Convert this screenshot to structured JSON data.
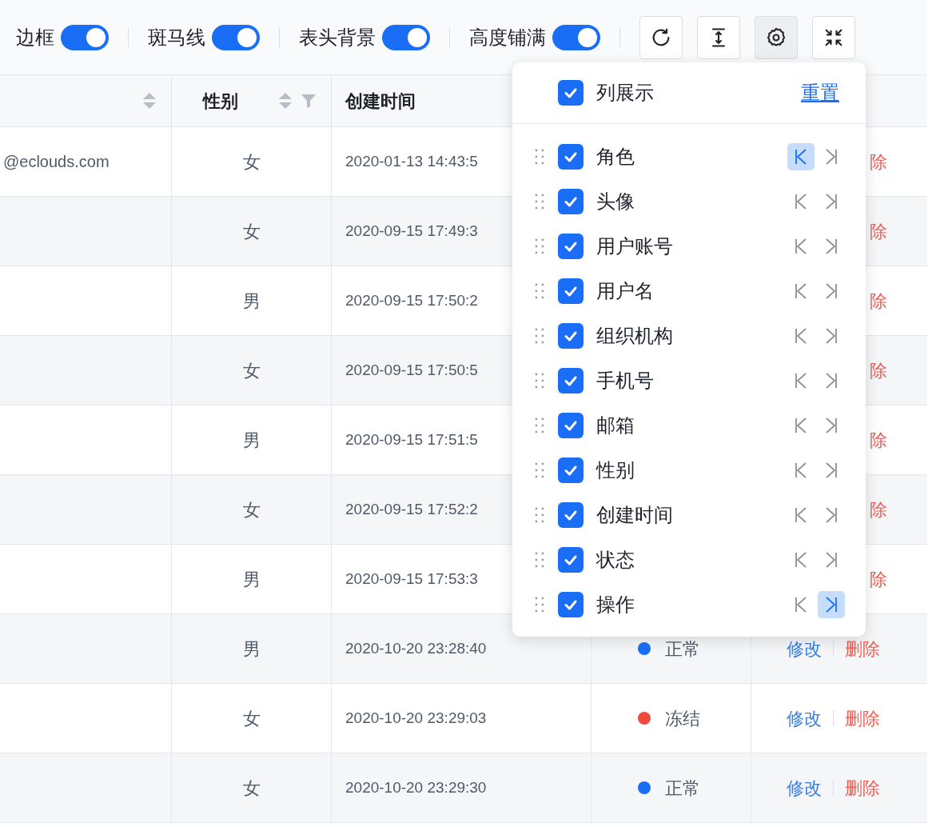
{
  "toolbar": {
    "toggles": [
      {
        "label": "边框",
        "on": true
      },
      {
        "label": "斑马线",
        "on": true
      },
      {
        "label": "表头背景",
        "on": true
      },
      {
        "label": "高度铺满",
        "on": true
      }
    ],
    "buttons": [
      {
        "kind": "refresh",
        "active": false
      },
      {
        "kind": "height",
        "active": false
      },
      {
        "kind": "settings",
        "active": true
      },
      {
        "kind": "fullscreen",
        "active": false
      }
    ]
  },
  "table": {
    "columns": [
      {
        "sortable": true
      },
      {
        "label": "性别",
        "sortable": true,
        "filterable": true
      },
      {
        "label": "创建时间"
      }
    ],
    "rows": [
      {
        "column_1": "@eclouds.com",
        "gender": "女",
        "created": "2020-01-13 14:43:5",
        "actions": [
          {
            "label": "除",
            "kind": "delete"
          }
        ]
      },
      {
        "gender": "女",
        "created": "2020-09-15 17:49:3",
        "actions": [
          {
            "label": "除",
            "kind": "delete"
          }
        ]
      },
      {
        "gender": "男",
        "created": "2020-09-15 17:50:2",
        "actions": [
          {
            "label": "除",
            "kind": "delete"
          }
        ]
      },
      {
        "gender": "女",
        "created": "2020-09-15 17:50:5",
        "actions": [
          {
            "label": "除",
            "kind": "delete"
          }
        ]
      },
      {
        "gender": "男",
        "created": "2020-09-15 17:51:5",
        "actions": [
          {
            "label": "除",
            "kind": "delete"
          }
        ]
      },
      {
        "gender": "女",
        "created": "2020-09-15 17:52:2",
        "actions": [
          {
            "label": "除",
            "kind": "delete"
          }
        ]
      },
      {
        "gender": "男",
        "created": "2020-09-15 17:53:3",
        "actions": [
          {
            "label": "除",
            "kind": "delete"
          }
        ]
      },
      {
        "gender": "男",
        "created": "2020-10-20 23:28:40",
        "status": {
          "label": "正常",
          "color": "#1a6ef5"
        },
        "actions": [
          {
            "label": "修改",
            "kind": "edit"
          },
          {
            "label": "删除",
            "kind": "delete"
          }
        ]
      },
      {
        "gender": "女",
        "created": "2020-10-20 23:29:03",
        "status": {
          "label": "冻结",
          "color": "#f04a3e"
        },
        "actions": [
          {
            "label": "修改",
            "kind": "edit"
          },
          {
            "label": "删除",
            "kind": "delete"
          }
        ]
      },
      {
        "gender": "女",
        "created": "2020-10-20 23:29:30",
        "status": {
          "label": "正常",
          "color": "#1a6ef5"
        },
        "actions": [
          {
            "label": "修改",
            "kind": "edit"
          },
          {
            "label": "删除",
            "kind": "delete"
          }
        ]
      }
    ]
  },
  "column_settings": {
    "title": "列展示",
    "all_checked": true,
    "reset": "重置",
    "columns": [
      {
        "label": "角色",
        "checked": true,
        "pinned_left": true,
        "pinned_right": false
      },
      {
        "label": "头像",
        "checked": true,
        "pinned_left": false,
        "pinned_right": false
      },
      {
        "label": "用户账号",
        "checked": true,
        "pinned_left": false,
        "pinned_right": false
      },
      {
        "label": "用户名",
        "checked": true,
        "pinned_left": false,
        "pinned_right": false
      },
      {
        "label": "组织机构",
        "checked": true,
        "pinned_left": false,
        "pinned_right": false
      },
      {
        "label": "手机号",
        "checked": true,
        "pinned_left": false,
        "pinned_right": false
      },
      {
        "label": "邮箱",
        "checked": true,
        "pinned_left": false,
        "pinned_right": false
      },
      {
        "label": "性别",
        "checked": true,
        "pinned_left": false,
        "pinned_right": false
      },
      {
        "label": "创建时间",
        "checked": true,
        "pinned_left": false,
        "pinned_right": false
      },
      {
        "label": "状态",
        "checked": true,
        "pinned_left": false,
        "pinned_right": false
      },
      {
        "label": "操作",
        "checked": true,
        "pinned_left": false,
        "pinned_right": true
      }
    ]
  }
}
